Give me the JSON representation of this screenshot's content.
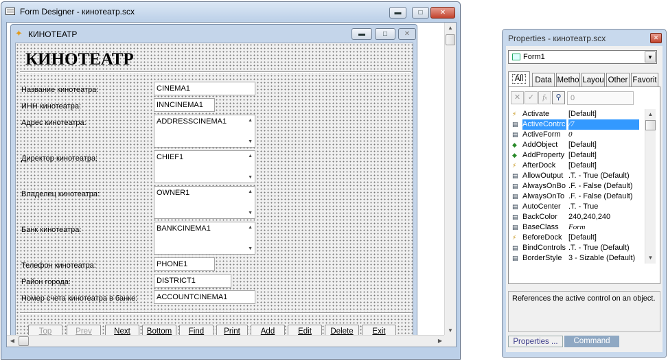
{
  "form_designer": {
    "title": "Form Designer - кинотеатр.scx",
    "form": {
      "title": "КИНОТЕАТР",
      "heading": "КИНОТЕАТР",
      "fields": [
        {
          "label": "Название кинотеатра:",
          "value": "CINEMA1",
          "kind": "textbox"
        },
        {
          "label": "ИНН кинотеатра:",
          "value": "INNCINEMA1",
          "kind": "textbox"
        },
        {
          "label": "Адрес кинотеатра:",
          "value": "ADDRESSCINEMA1",
          "kind": "editbox"
        },
        {
          "label": "Директор кинотеатра:",
          "value": "CHIEF1",
          "kind": "editbox"
        },
        {
          "label": "Владелец кинотеатра:",
          "value": "OWNER1",
          "kind": "editbox"
        },
        {
          "label": "Банк кинотеатра:",
          "value": "BANKCINEMA1",
          "kind": "editbox"
        },
        {
          "label": "Телефон кинотеатра:",
          "value": "PHONE1",
          "kind": "textbox"
        },
        {
          "label": "Район города:",
          "value": "DISTRICT1",
          "kind": "textbox"
        },
        {
          "label": "Номер счета кинотеатра в банке:",
          "value": "ACCOUNTCINEMA1",
          "kind": "textbox"
        }
      ],
      "buttons": [
        {
          "label": "Top",
          "enabled": false
        },
        {
          "label": "Prev",
          "enabled": false
        },
        {
          "label": "Next",
          "enabled": true
        },
        {
          "label": "Bottom",
          "enabled": true
        },
        {
          "label": "Find",
          "enabled": true
        },
        {
          "label": "Print",
          "enabled": true
        },
        {
          "label": "Add",
          "enabled": true
        },
        {
          "label": "Edit",
          "enabled": true
        },
        {
          "label": "Delete",
          "enabled": true
        },
        {
          "label": "Exit",
          "enabled": true
        }
      ]
    }
  },
  "properties": {
    "title": "Properties - кинотеатр.scx",
    "object": "Form1",
    "tabs": [
      "All",
      "Data",
      "Metho",
      "Layou",
      "Other",
      "Favorit"
    ],
    "active_tab": "All",
    "value_box": "0",
    "rows": [
      {
        "icon": "event",
        "name": "Activate",
        "value": "[Default]"
      },
      {
        "icon": "prop",
        "name": "ActiveContrc",
        "value": "/7",
        "italic": true,
        "selected": true
      },
      {
        "icon": "prop",
        "name": "ActiveForm",
        "value": "0",
        "italic": true
      },
      {
        "icon": "method",
        "name": "AddObject",
        "value": "[Default]"
      },
      {
        "icon": "method",
        "name": "AddProperty",
        "value": "[Default]"
      },
      {
        "icon": "event",
        "name": "AfterDock",
        "value": "[Default]"
      },
      {
        "icon": "prop",
        "name": "AllowOutput",
        "value": ".T. - True (Default)"
      },
      {
        "icon": "prop",
        "name": "AlwaysOnBo",
        "value": ".F. - False (Default)"
      },
      {
        "icon": "prop",
        "name": "AlwaysOnTo",
        "value": ".F. - False (Default)"
      },
      {
        "icon": "prop",
        "name": "AutoCenter",
        "value": ".T. - True"
      },
      {
        "icon": "prop",
        "name": "BackColor",
        "value": "240,240,240"
      },
      {
        "icon": "prop",
        "name": "BaseClass",
        "value": "Form",
        "italic": true
      },
      {
        "icon": "event",
        "name": "BeforeDock",
        "value": "[Default]"
      },
      {
        "icon": "prop",
        "name": "BindControls",
        "value": ".T. - True (Default)"
      },
      {
        "icon": "prop",
        "name": "BorderStyle",
        "value": "3 - Sizable (Default)"
      }
    ],
    "description": "References the active control on an object.",
    "bottom_tabs": [
      "Properties ...",
      "Command"
    ],
    "active_bottom_tab": "Properties ..."
  },
  "colors": {
    "selection": "#3399ff",
    "window_frame": "#bcd0e8"
  }
}
